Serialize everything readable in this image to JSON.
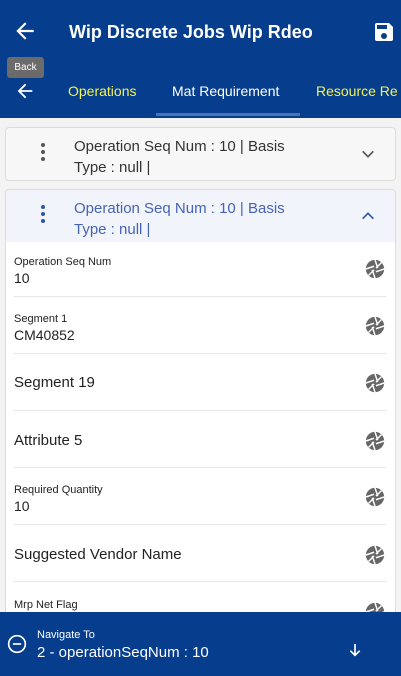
{
  "header": {
    "title": "Wip Discrete Jobs Wip Rdeo",
    "tooltip": "Back"
  },
  "tabs": [
    {
      "label": "Operations"
    },
    {
      "label": "Mat Requirement"
    },
    {
      "label": "Resource Re"
    }
  ],
  "cards": [
    {
      "line1": "Operation Seq Num  : 10 | Basis",
      "line2": "Type  : null |"
    },
    {
      "line1": "Operation Seq Num  : 10 | Basis",
      "line2": "Type  : null |"
    }
  ],
  "fields": [
    {
      "label": "Operation Seq Num",
      "value": "10"
    },
    {
      "label": "Segment 1",
      "value": "CM40852"
    },
    {
      "label": "Segment 19"
    },
    {
      "label": "Attribute 5"
    },
    {
      "label": "Required Quantity",
      "value": "10"
    },
    {
      "label": "Suggested Vendor Name"
    },
    {
      "label": "Mrp Net Flag"
    }
  ],
  "bottom": {
    "navigate_label": "Navigate To",
    "navigate_value": "2 - operationSeqNum : 10"
  },
  "colors": {
    "primary": "#063d8c",
    "tab_accent": "#f2f25a",
    "active_card_text": "#4664b4"
  }
}
